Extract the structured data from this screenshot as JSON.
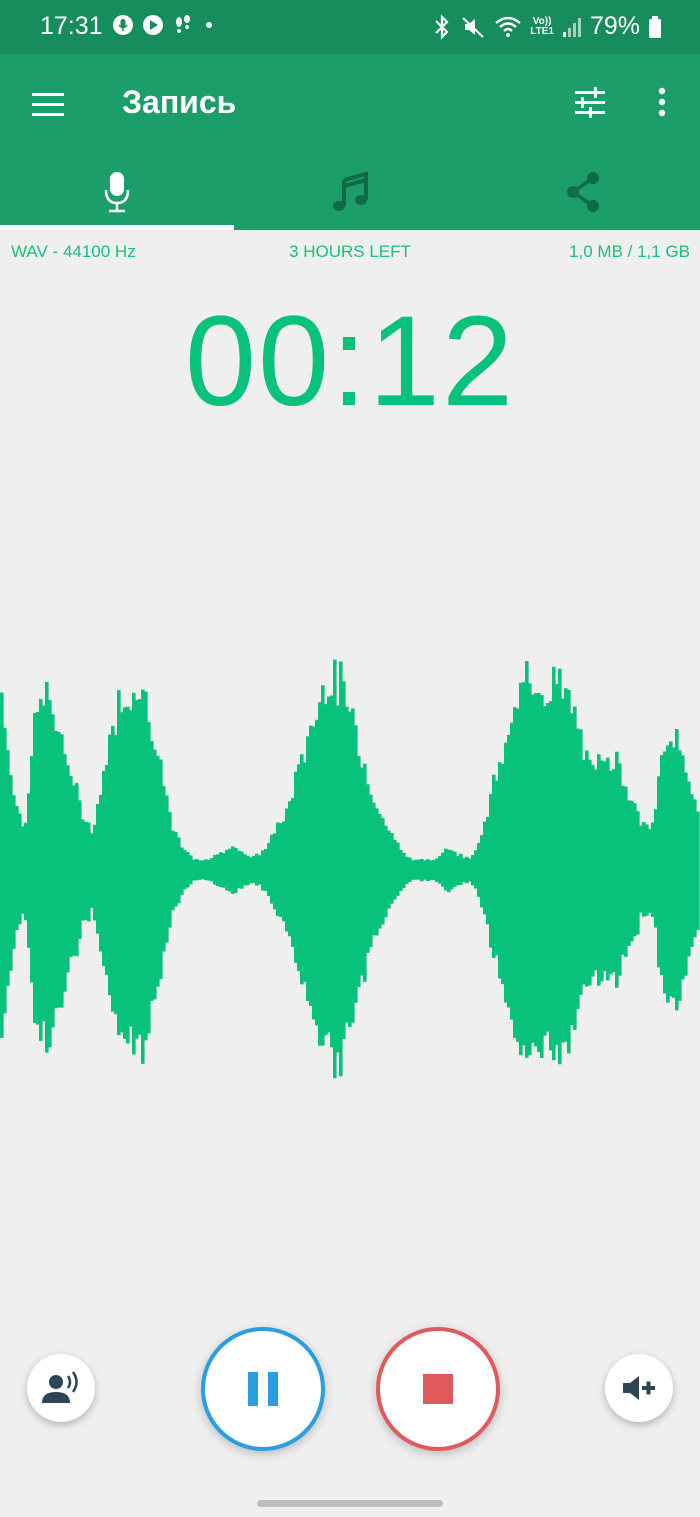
{
  "status_bar": {
    "time": "17:31",
    "battery": "79%",
    "network_label": "LTE1",
    "volte_label": "Vo))"
  },
  "app_bar": {
    "title": "Запись",
    "menu_icon": "hamburger-menu-icon",
    "tune_icon": "tune-sliders-icon",
    "more_icon": "more-vertical-icon"
  },
  "tabs": [
    {
      "icon": "microphone-icon",
      "active": true
    },
    {
      "icon": "music-note-icon",
      "active": false
    },
    {
      "icon": "share-icon",
      "active": false
    }
  ],
  "info": {
    "format": "WAV - 44100 Hz",
    "time_left": "3 HOURS LEFT",
    "size": "1,0 MB / 1,1 GB"
  },
  "timer": "00:12",
  "colors": {
    "status_bar": "#178c5c",
    "app_bar": "#1b9e69",
    "accent": "#08c27c",
    "pause": "#2a9ee0",
    "stop": "#e05a5c",
    "background": "#efefef"
  },
  "controls": {
    "voice_icon": "speaking-person-icon",
    "pause_icon": "pause-icon",
    "stop_icon": "stop-icon",
    "volume_icon": "volume-up-icon"
  },
  "waveform_amplitudes": [
    0.9,
    0.4,
    0.2,
    0.8,
    0.9,
    0.7,
    0.5,
    0.3,
    0.2,
    0.5,
    0.8,
    0.9,
    0.95,
    0.8,
    0.5,
    0.2,
    0.1,
    0.05,
    0.05,
    0.08,
    0.12,
    0.1,
    0.06,
    0.1,
    0.2,
    0.3,
    0.5,
    0.7,
    0.9,
    1.0,
    0.9,
    0.7,
    0.5,
    0.3,
    0.2,
    0.1,
    0.05,
    0.05,
    0.05,
    0.12,
    0.08,
    0.06,
    0.15,
    0.4,
    0.6,
    0.8,
    0.95,
    1.0,
    0.9,
    0.95,
    0.8,
    0.6,
    0.5,
    0.6,
    0.55,
    0.4,
    0.25,
    0.2,
    0.6,
    0.7,
    0.5,
    0.3
  ]
}
